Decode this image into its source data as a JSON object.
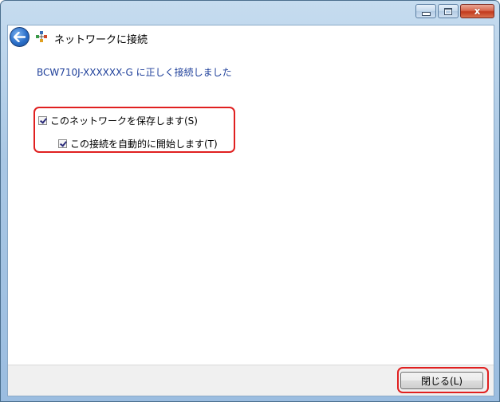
{
  "window": {
    "title": "ネットワークに接続",
    "caption": {
      "minimize_icon": "minimize-icon",
      "maximize_icon": "maximize-icon",
      "close_icon": "close-icon",
      "close_glyph": "x"
    }
  },
  "header": {
    "back_icon": "back-arrow-icon",
    "network_icon": "network-icon"
  },
  "content": {
    "success_message": "BCW710J-XXXXXX-G に正しく接続しました",
    "options": [
      {
        "label": "このネットワークを保存します(S)",
        "checked": true
      },
      {
        "label": "この接続を自動的に開始します(T)",
        "checked": true
      }
    ]
  },
  "footer": {
    "close_button": "閉じる(L)"
  },
  "colors": {
    "link_text": "#1e3f9a",
    "highlight": "#e02020",
    "titlebar": "#a9c7e4"
  }
}
